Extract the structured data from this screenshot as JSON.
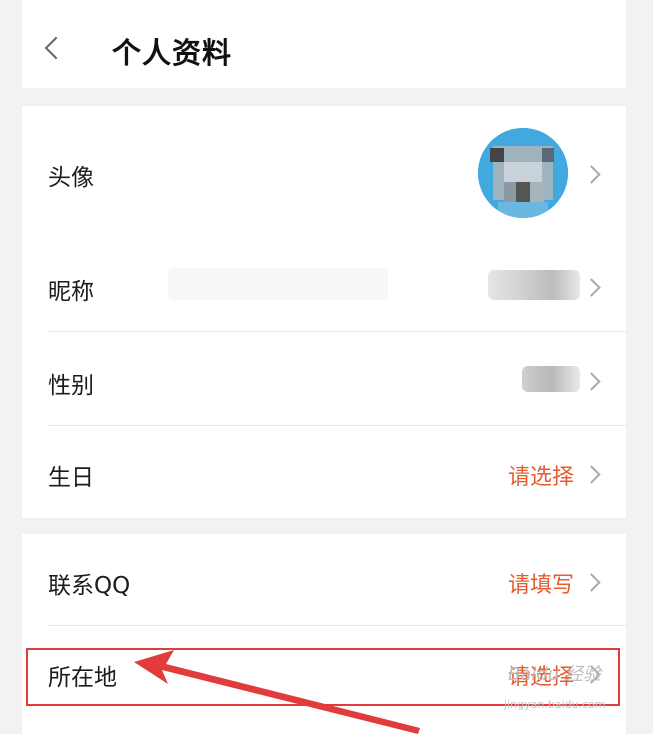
{
  "header": {
    "title": "个人资料"
  },
  "profile": {
    "avatar_label": "头像",
    "nickname_label": "昵称",
    "gender_label": "性别",
    "birthday_label": "生日",
    "birthday_value": "请选择"
  },
  "contact": {
    "qq_label": "联系QQ",
    "qq_value": "请填写",
    "location_label": "所在地",
    "location_value": "请选择"
  },
  "watermark": {
    "logo": "Baidu 经验",
    "url": "jingyan.baidu.com"
  },
  "colors": {
    "accent": "#e65c2e",
    "highlight": "#e23b3b"
  }
}
